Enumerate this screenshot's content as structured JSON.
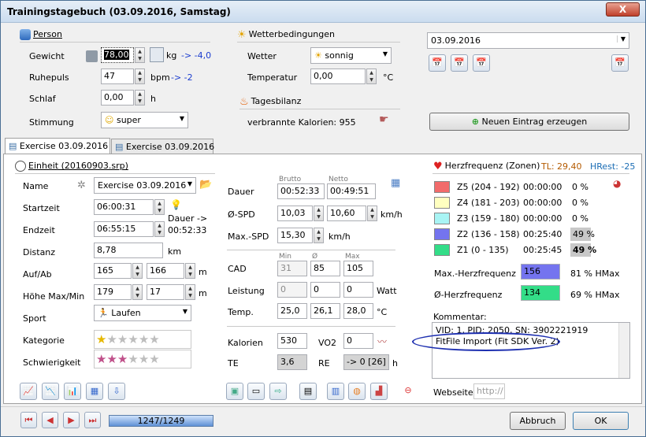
{
  "window": {
    "title": "Trainingstagebuch (03.09.2016, Samstag)",
    "close": "X"
  },
  "person": {
    "header": "Person",
    "gewicht": {
      "label": "Gewicht",
      "value": "78,00",
      "unit": "kg",
      "delta": "-> -4,0"
    },
    "ruhepuls": {
      "label": "Ruhepuls",
      "value": "47",
      "unit": "bpm",
      "delta": "-> -2"
    },
    "schlaf": {
      "label": "Schlaf",
      "value": "0,00",
      "unit": "h"
    },
    "stimmung": {
      "label": "Stimmung",
      "value": "super"
    }
  },
  "wetter": {
    "header": "Wetterbedingungen",
    "wetter_label": "Wetter",
    "wetter_value": "sonnig",
    "temp_label": "Temperatur",
    "temp_value": "0,00",
    "temp_unit": "°C"
  },
  "tagesbilanz": {
    "header": "Tagesbilanz",
    "kalorien": "verbrannte Kalorien: 955"
  },
  "date": {
    "value": "03.09.2016"
  },
  "new_entry_button": "Neuen Eintrag erzeugen",
  "tabs": [
    "Exercise 03.09.2016",
    "Exercise 03.09.2016"
  ],
  "einheit": {
    "header": "Einheit (20160903.srp)",
    "name_label": "Name",
    "name_value": "Exercise 03.09.2016",
    "startzeit_label": "Startzeit",
    "startzeit_value": "06:00:31",
    "endzeit_label": "Endzeit",
    "endzeit_value": "06:55:15",
    "dauer_note_1": "Dauer ->",
    "dauer_note_2": "00:52:33",
    "distanz_label": "Distanz",
    "distanz_value": "8,78",
    "distanz_unit": "km",
    "aufab_label": "Auf/Ab",
    "auf_value": "165",
    "ab_value": "166",
    "aufab_unit": "m",
    "hoehe_label": "Höhe Max/Min",
    "hoehe_max": "179",
    "hoehe_min": "17",
    "hoehe_unit": "m",
    "sport_label": "Sport",
    "sport_value": "Laufen",
    "kategorie_label": "Kategorie",
    "kategorie_stars": 1,
    "schwierigkeit_label": "Schwierigkeit",
    "schwierigkeit_stars": 3
  },
  "stats": {
    "brutto": "Brutto",
    "netto": "Netto",
    "dauer_label": "Dauer",
    "dauer_brutto": "00:52:33",
    "dauer_netto": "00:49:51",
    "spd_label": "Ø-SPD",
    "spd_brutto": "10,03",
    "spd_netto": "10,60",
    "spd_unit": "km/h",
    "maxspd_label": "Max.-SPD",
    "maxspd_value": "15,30",
    "maxspd_unit": "km/h",
    "min": "Min",
    "avg": "Ø",
    "max": "Max",
    "cad_label": "CAD",
    "cad_min": "31",
    "cad_avg": "85",
    "cad_max": "105",
    "leistung_label": "Leistung",
    "leistung_min": "0",
    "leistung_avg": "0",
    "leistung_max": "0",
    "leistung_unit": "Watt",
    "temp_label": "Temp.",
    "temp_min": "25,0",
    "temp_avg": "26,1",
    "temp_max": "28,0",
    "temp_unit": "°C",
    "kalorien_label": "Kalorien",
    "kalorien_value": "530",
    "vo2_label": "VO2",
    "vo2_value": "0",
    "te_label": "TE",
    "te_value": "3,6",
    "re_label": "RE",
    "re_value": "-> 0 [26]",
    "re_unit": "h"
  },
  "herz": {
    "header": "Herzfrequenz (Zonen)",
    "tl": "TL: 29,40",
    "hrest": "HRest: -25",
    "zones": [
      {
        "label": "Z5 (204 - 192)",
        "time": "00:00:00",
        "pct": "0 %",
        "color": "#f26b6b"
      },
      {
        "label": "Z4 (181 - 203)",
        "time": "00:00:00",
        "pct": "0 %",
        "color": "#ffffc0"
      },
      {
        "label": "Z3 (159 - 180)",
        "time": "00:00:00",
        "pct": "0 %",
        "color": "#a8f4f4"
      },
      {
        "label": "Z2 (136 - 158)",
        "time": "00:25:40",
        "pct": "49 %",
        "color": "#7474ef"
      },
      {
        "label": "Z1 (0 - 135)",
        "time": "00:25:45",
        "pct": "49 %",
        "color": "#33dd88"
      }
    ],
    "max_label": "Max.-Herzfrequenz",
    "max_value": "156",
    "max_pct": "81 % HMax",
    "avg_label": "Ø-Herzfrequenz",
    "avg_value": "134",
    "avg_pct": "69 % HMax"
  },
  "kommentar": {
    "label": "Kommentar:",
    "line1": "VID: 1, PID: 2050, SN: 3902221919",
    "line2": "FitFile Import (Fit SDK Ver. 2)"
  },
  "webseite": {
    "label": "Webseite:",
    "placeholder": "http://"
  },
  "nav": {
    "progress": "1247/1249",
    "progress_fraction": 0.998
  },
  "buttons": {
    "abbruch": "Abbruch",
    "ok": "OK"
  }
}
